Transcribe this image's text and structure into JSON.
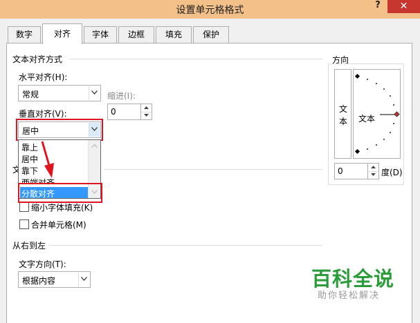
{
  "window": {
    "title": "设置单元格格式",
    "help_label": "?",
    "close_label": "✕"
  },
  "tabs": [
    {
      "label": "数字"
    },
    {
      "label": "对齐"
    },
    {
      "label": "字体"
    },
    {
      "label": "边框"
    },
    {
      "label": "填充"
    },
    {
      "label": "保护"
    }
  ],
  "active_tab": "对齐",
  "text_alignment": {
    "group_title": "文本对齐方式",
    "horizontal_label": "水平对齐(H):",
    "horizontal_value": "常规",
    "indent_label": "缩进(I):",
    "indent_value": "0",
    "vertical_label": "垂直对齐(V):",
    "vertical_value": "居中",
    "vertical_options": [
      "靠上",
      "居中",
      "靠下",
      "两端对齐",
      "分散对齐"
    ],
    "vertical_highlighted_option": "分散对齐"
  },
  "text_control": {
    "group_title_visible": "文",
    "shrink_label": "缩小字体填充(K)",
    "merge_label": "合并单元格(M)"
  },
  "rtl": {
    "group_title": "从右到左",
    "direction_label": "文字方向(T):",
    "direction_value": "根据内容"
  },
  "orientation": {
    "group_title": "方向",
    "vertical_text": [
      "文",
      "本"
    ],
    "dial_text": "文本",
    "degrees_value": "0",
    "degrees_label": "度(D)"
  },
  "watermark": {
    "main": "百科全说",
    "sub": "助你轻松解决"
  },
  "colors": {
    "titlebar": "#f4c08a",
    "close": "#c7372f",
    "annotation_red": "#e0141e",
    "selection_blue": "#3399ff",
    "watermark_green": "#2a9c3a"
  }
}
